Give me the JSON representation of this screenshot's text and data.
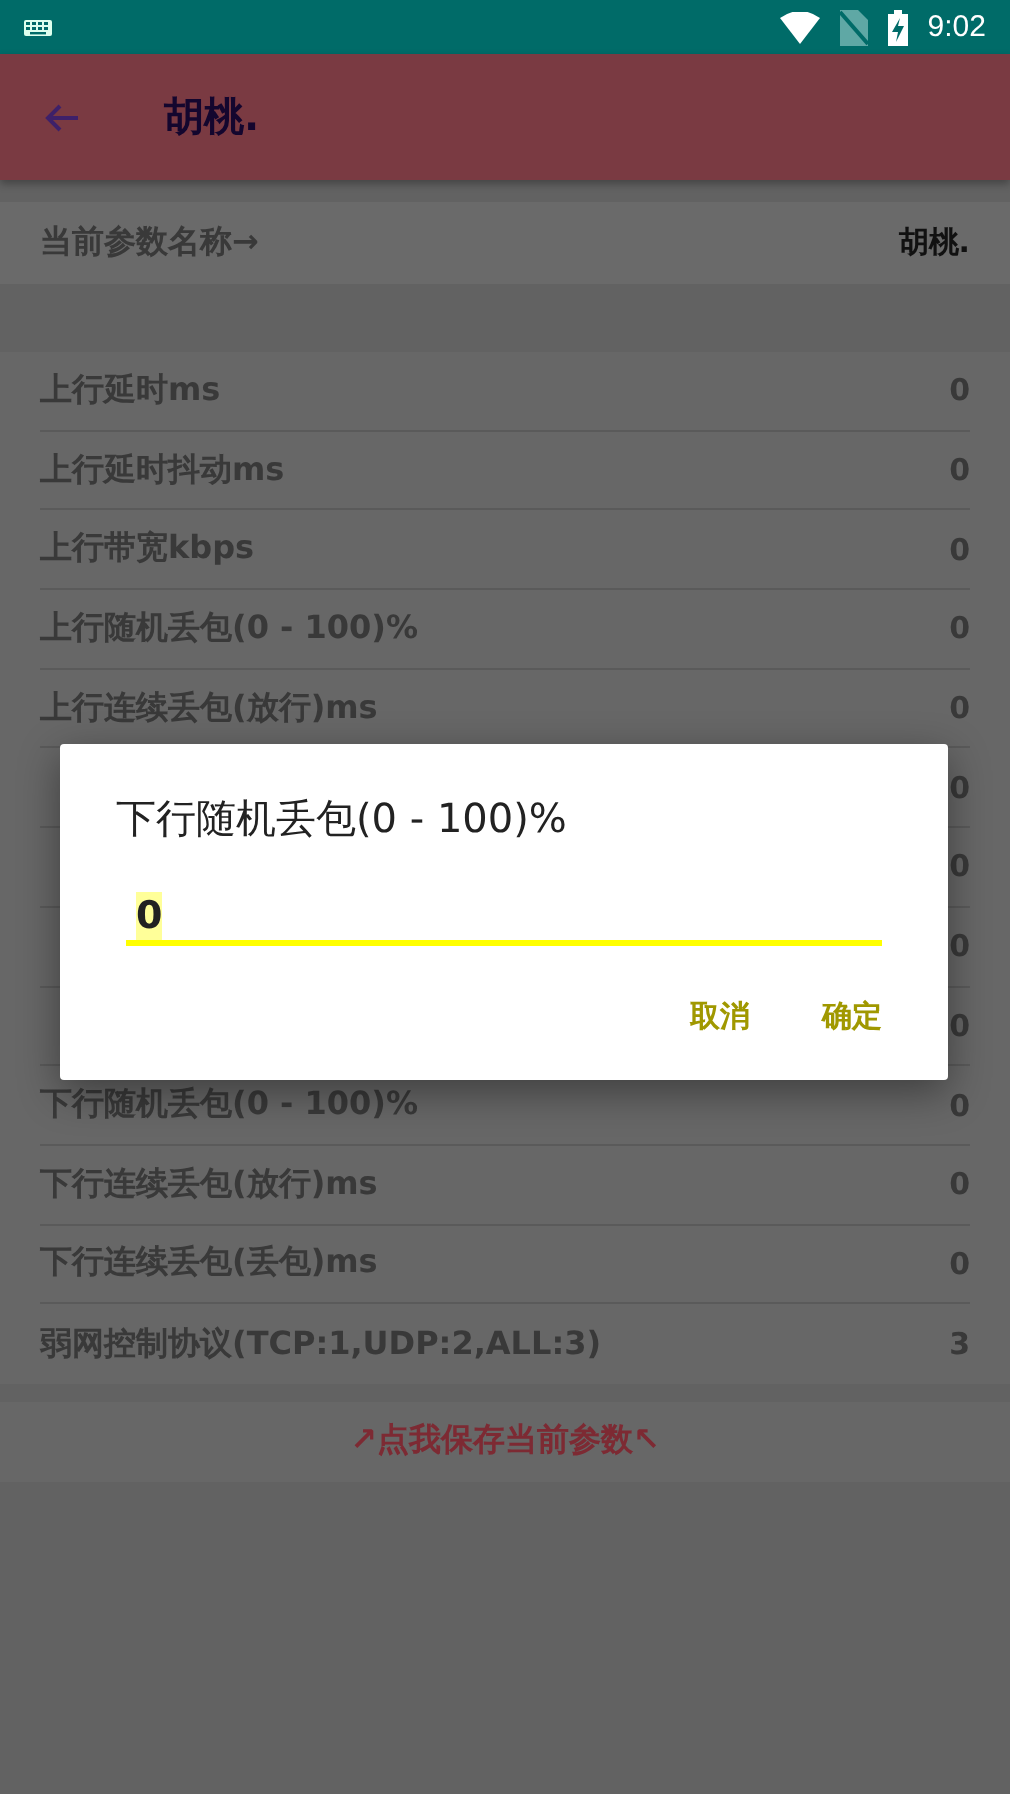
{
  "status_bar": {
    "time": "9:02"
  },
  "app_bar": {
    "title": "胡桃."
  },
  "current_param": {
    "label": "当前参数名称→",
    "value": "胡桃."
  },
  "params": [
    {
      "label": "上行延时ms",
      "value": "0"
    },
    {
      "label": "上行延时抖动ms",
      "value": "0"
    },
    {
      "label": "上行带宽kbps",
      "value": "0"
    },
    {
      "label": "上行随机丢包(0 - 100)%",
      "value": "0"
    },
    {
      "label": "上行连续丢包(放行)ms",
      "value": "0"
    },
    {
      "value": "0"
    },
    {
      "value": "0"
    },
    {
      "value": "0"
    },
    {
      "value": "0"
    },
    {
      "label": "下行随机丢包(0 - 100)%",
      "value": "0"
    },
    {
      "label": "下行连续丢包(放行)ms",
      "value": "0"
    },
    {
      "label": "下行连续丢包(丢包)ms",
      "value": "0"
    },
    {
      "label": "弱网控制协议(TCP:1,UDP:2,ALL:3)",
      "value": "3"
    }
  ],
  "save_button": "↗点我保存当前参数↖",
  "dialog": {
    "title": "下行随机丢包(0 - 100)%",
    "value": "0",
    "buttons": [
      "取消",
      "确定"
    ]
  }
}
